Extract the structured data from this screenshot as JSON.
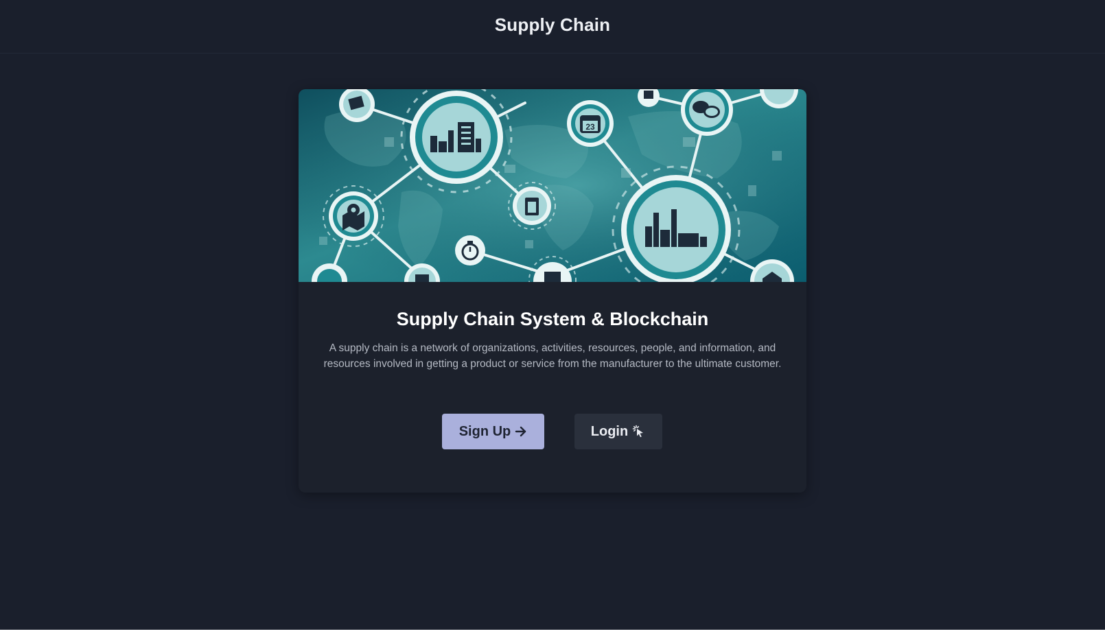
{
  "header": {
    "title": "Supply Chain"
  },
  "card": {
    "title": "Supply Chain System & Blockchain",
    "description": "A supply chain is a network of organizations, activities, resources, people, and information, and resources involved in getting a product or service from the manufacturer to the ultimate customer.",
    "image_icon": "supply-chain-network-illustration"
  },
  "actions": {
    "signup_label": "Sign Up",
    "signup_icon": "arrow-right-icon",
    "login_label": "Login",
    "login_icon": "cursor-click-icon"
  },
  "colors": {
    "page_bg": "#1a1f2c",
    "card_bg": "#1c212c",
    "signup_bg": "#aab0dc",
    "login_bg": "#2a303c",
    "hero_teal": "#1f7f8a"
  }
}
